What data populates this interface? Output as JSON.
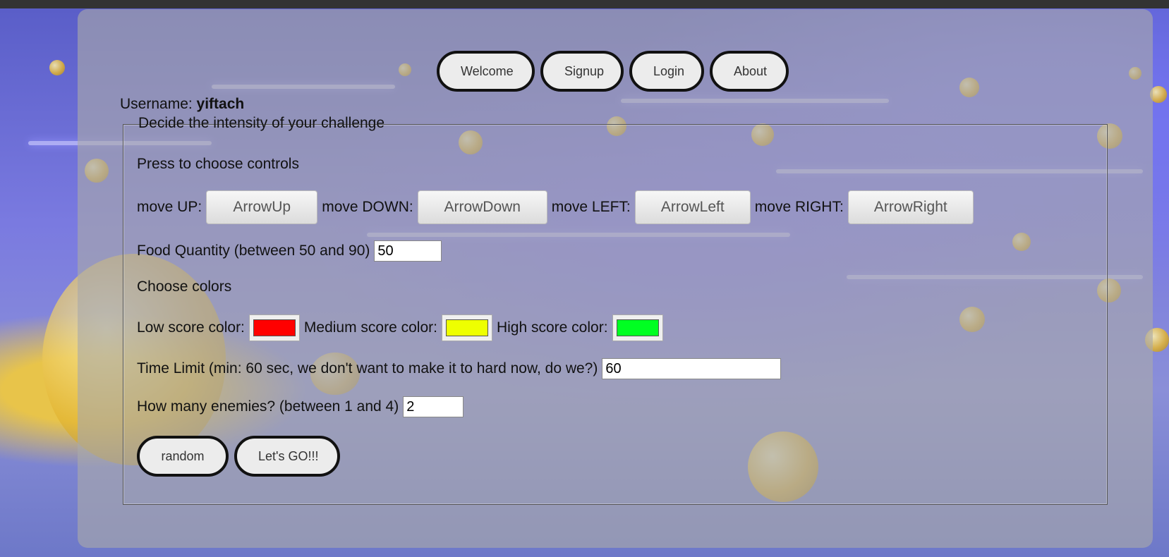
{
  "nav": {
    "items": [
      "Welcome",
      "Signup",
      "Login",
      "About"
    ]
  },
  "user": {
    "label": "Username:",
    "name": "yiftach"
  },
  "form": {
    "legend": "Decide the intensity of your challenge",
    "controls_heading": "Press to choose controls",
    "controls": [
      {
        "label": "move UP:",
        "key": "ArrowUp"
      },
      {
        "label": "move DOWN:",
        "key": "ArrowDown"
      },
      {
        "label": "move LEFT:",
        "key": "ArrowLeft"
      },
      {
        "label": "move RIGHT:",
        "key": "ArrowRight"
      }
    ],
    "food": {
      "label": "Food Quantity (between 50 and 90)",
      "value": "50"
    },
    "colors_heading": "Choose colors",
    "colors": [
      {
        "label": "Low score color:",
        "value": "#ff0000"
      },
      {
        "label": "Medium score color:",
        "value": "#eeff00"
      },
      {
        "label": "High score color:",
        "value": "#00ff22"
      }
    ],
    "time": {
      "label": "Time Limit (min: 60 sec, we don't want to make it to hard now, do we?)",
      "value": "60"
    },
    "enemies": {
      "label": "How many enemies? (between 1 and 4)",
      "value": "2"
    },
    "random_label": "random",
    "go_label": "Let's GO!!!"
  }
}
